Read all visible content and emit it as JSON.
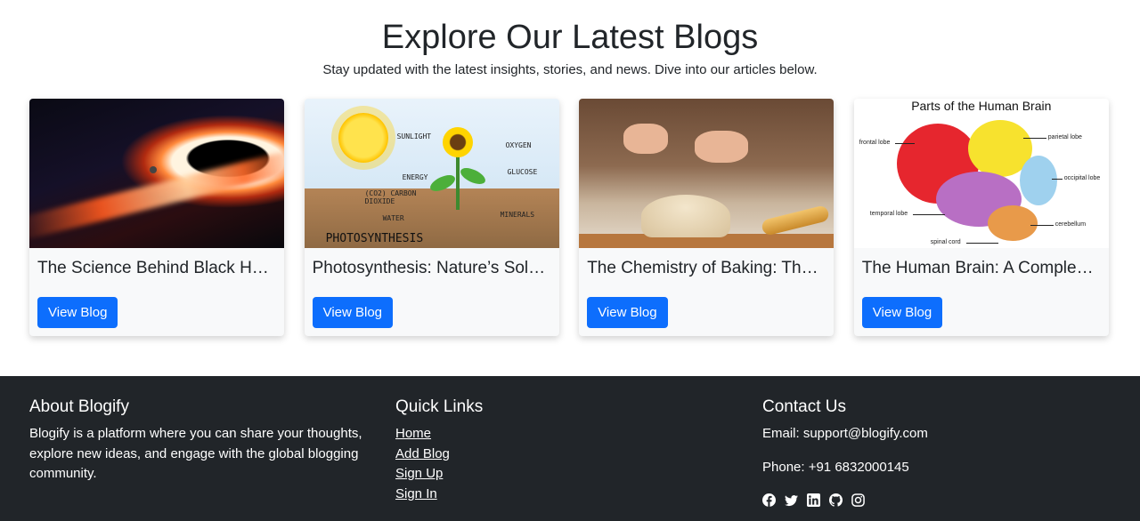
{
  "hero": {
    "title": "Explore Our Latest Blogs",
    "subtitle": "Stay updated with the latest insights, stories, and news. Dive into our articles below."
  },
  "cards": [
    {
      "title": "The Science Behind Black Holes",
      "button": "View Blog",
      "image": "black-hole-image"
    },
    {
      "title": "Photosynthesis: Nature’s Solar Power",
      "button": "View Blog",
      "image": "photosynthesis-image"
    },
    {
      "title": "The Chemistry of Baking: The Science Behind Bread",
      "button": "View Blog",
      "image": "baking-image"
    },
    {
      "title": "The Human Brain: A Complex Organ",
      "button": "View Blog",
      "image": "human-brain-image"
    }
  ],
  "photosynthesis_labels": {
    "sunlight": "SUNLIGHT",
    "energy": "ENERGY",
    "oxygen": "OXYGEN",
    "glucose": "GLUCOSE",
    "co2": "(CO2) CARBON DIOXIDE",
    "water": "WATER",
    "minerals": "MINERALS",
    "title": "PHOTOSYNTHESIS"
  },
  "brain_labels": {
    "title": "Parts of the Human Brain",
    "frontal": "frontal lobe",
    "parietal": "parietal lobe",
    "occipital": "occipital lobe",
    "temporal": "temporal lobe",
    "cerebellum": "cerebellum",
    "spinal": "spinal cord"
  },
  "footer": {
    "about": {
      "heading": "About Blogify",
      "text": "Blogify is a platform where you can share your thoughts, explore new ideas, and engage with the global blogging community."
    },
    "links": {
      "heading": "Quick Links",
      "items": [
        "Home",
        "Add Blog",
        "Sign Up",
        "Sign In"
      ]
    },
    "contact": {
      "heading": "Contact Us",
      "email": "Email: support@blogify.com",
      "phone": "Phone: +91 6832000145",
      "socials": [
        "facebook-icon",
        "twitter-icon",
        "linkedin-icon",
        "github-icon",
        "instagram-icon"
      ]
    }
  },
  "colors": {
    "primary": "#0d6efd",
    "footer_bg": "#212529",
    "card_bg": "#f8f9fa"
  }
}
